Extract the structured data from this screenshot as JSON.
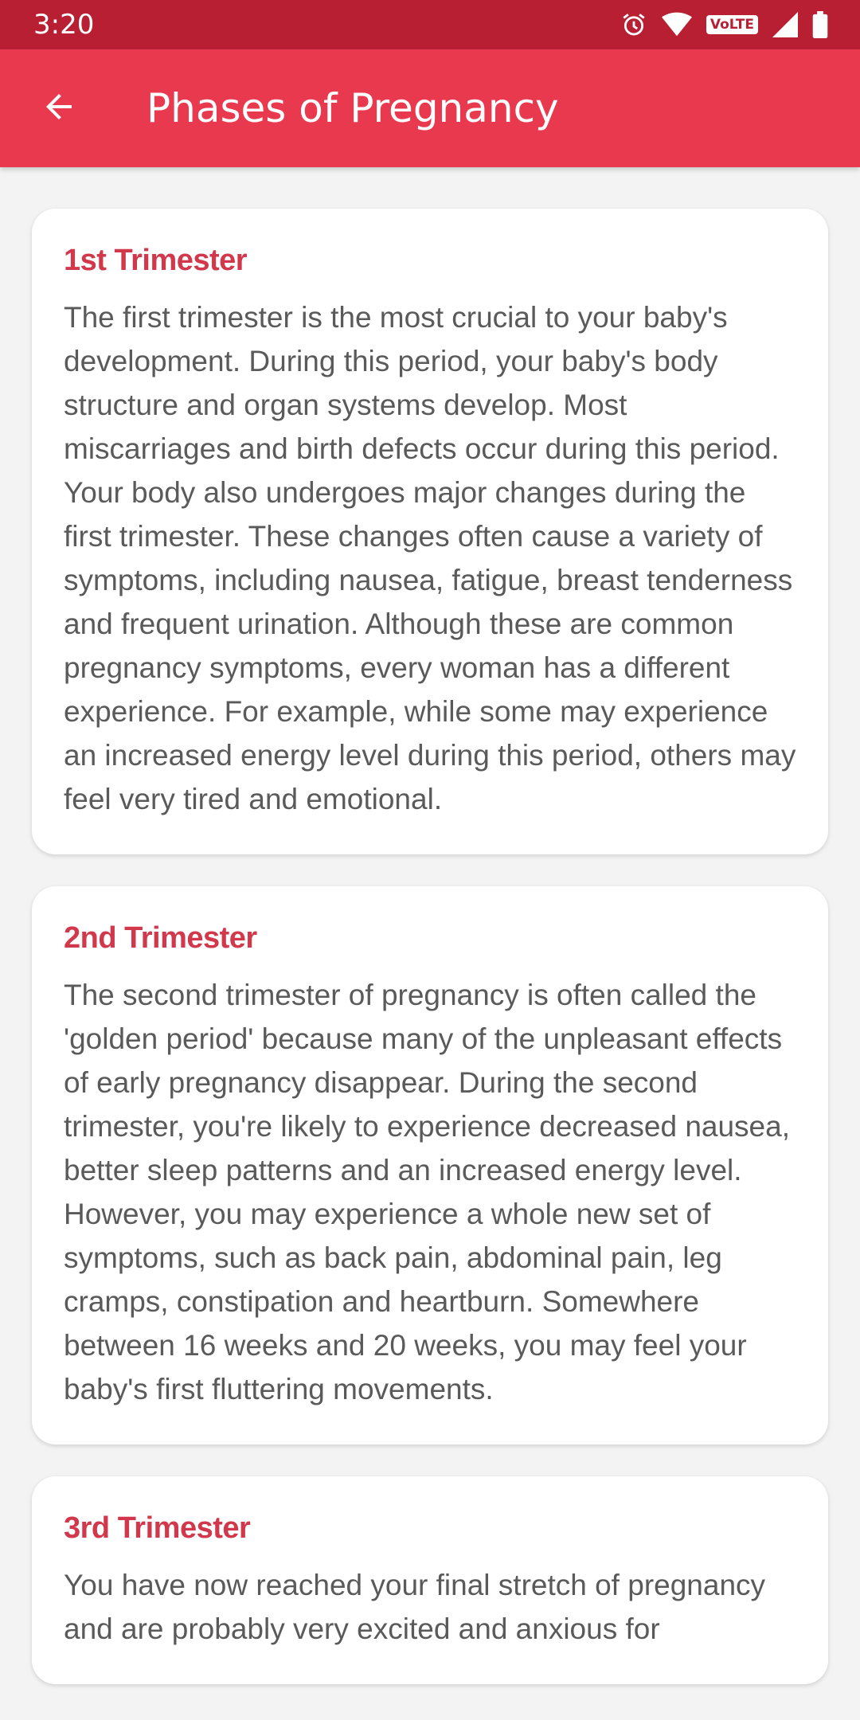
{
  "status_bar": {
    "time": "3:20",
    "icons": [
      "alarm-icon",
      "wifi-icon",
      "volte-badge",
      "signal-icon",
      "battery-icon"
    ],
    "volte_label": "VoLTE"
  },
  "app_bar": {
    "back_icon": "arrow-left-icon",
    "title": "Phases of Pregnancy"
  },
  "colors": {
    "status_bar": "#b81f33",
    "app_bar": "#e8394f",
    "card_title": "#d2384c",
    "body_text": "#5a5a5a",
    "background": "#f3f3f3"
  },
  "cards": [
    {
      "title": "1st Trimester",
      "body": "The first trimester is the most crucial to your baby's development. During this period, your baby's body structure and organ systems develop. Most miscarriages and birth defects occur during this period. Your body also undergoes major changes during the first trimester. These changes often cause a variety of symptoms, including nausea, fatigue, breast tenderness and frequent urination. Although these are common pregnancy symptoms, every woman has a different experience. For example, while some may experience an increased energy level during this period, others may feel very tired and emotional."
    },
    {
      "title": "2nd Trimester",
      "body": "The second trimester of pregnancy is often called the 'golden period' because many of the unpleasant effects of early pregnancy disappear. During the second trimester, you're likely to experience decreased nausea, better sleep patterns and an increased energy level. However, you may experience a whole new set of symptoms, such as back pain, abdominal pain, leg cramps, constipation and heartburn. Somewhere between 16 weeks and 20 weeks, you may feel your baby's first fluttering movements."
    },
    {
      "title": "3rd Trimester",
      "body": "You have now reached your final stretch of pregnancy and are probably very excited and anxious for"
    }
  ]
}
